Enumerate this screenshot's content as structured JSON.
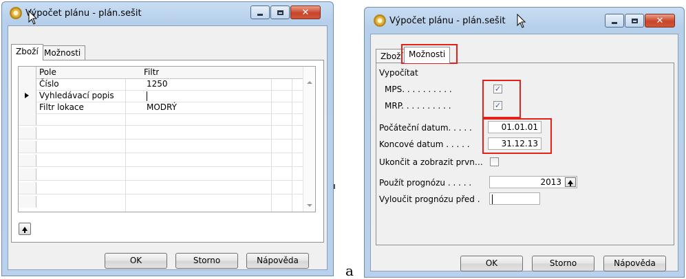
{
  "dialog_left": {
    "title": "Výpočet plánu - plán.sešit",
    "tabs": [
      {
        "label": "Zboží",
        "active": true
      },
      {
        "label": "Možnosti",
        "active": false
      }
    ],
    "grid": {
      "columns": [
        "Pole",
        "Filtr"
      ],
      "rows": [
        {
          "field": "Číslo",
          "filter": "1250"
        },
        {
          "field": "Vyhledávací popis",
          "filter": ""
        },
        {
          "field": "Filtr lokace",
          "filter": "MODRÝ"
        }
      ],
      "empty_rows": 7
    },
    "buttons": {
      "ok": "OK",
      "cancel": "Storno",
      "help": "Nápověda"
    }
  },
  "dialog_right": {
    "title": "Výpočet plánu - plán.sešit",
    "tabs": [
      {
        "label": "Zboží",
        "active": false
      },
      {
        "label": "Možnosti",
        "active": true
      }
    ],
    "options": {
      "section_label": "Vypočítat",
      "mps_label": "MPS. . . . . . . . . .",
      "mps_checked": true,
      "mrp_label": "MRP. . . . . . . . . .",
      "mrp_checked": true,
      "start_date_label": "Počáteční datum. . . . .",
      "start_date": "01.01.01",
      "end_date_label": "Koncové datum . . . . .",
      "end_date": "31.12.13",
      "stop_label": "Ukončit a zobrazit prvn…",
      "stop_checked": false,
      "forecast_label": "Použít prognózu . . . . .",
      "forecast_value": "2013",
      "exclude_label": "Vyloučit prognózu před  .",
      "exclude_value": ""
    },
    "buttons": {
      "ok": "OK",
      "cancel": "Storno",
      "help": "Nápověda"
    }
  },
  "separator_label": "a",
  "colors": {
    "highlight": "#e5201a",
    "frame": "#b9d1ec",
    "close_button": "#c8452b"
  }
}
